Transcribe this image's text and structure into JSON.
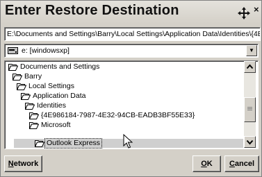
{
  "window": {
    "title": "Enter Restore Destination",
    "close_label": "×"
  },
  "path": {
    "value": "E:\\Documents and Settings\\Barry\\Local Settings\\Application Data\\Identities\\{4E"
  },
  "drive": {
    "value": "e: [windowsxp]"
  },
  "tree": {
    "items": [
      {
        "label": "Documents and Settings"
      },
      {
        "label": "Barry"
      },
      {
        "label": "Local Settings"
      },
      {
        "label": "Application Data"
      },
      {
        "label": "Identities"
      },
      {
        "label": "{4E986184-7987-4E32-94CB-EADB3BF55E33}"
      },
      {
        "label": "Microsoft"
      },
      {
        "label": "Outlook Express",
        "selected": true
      }
    ]
  },
  "buttons": {
    "network": {
      "hotkey": "N",
      "rest": "etwork"
    },
    "ok": {
      "hotkey": "O",
      "rest": "K"
    },
    "cancel": {
      "hotkey": "C",
      "rest": "ancel"
    }
  }
}
